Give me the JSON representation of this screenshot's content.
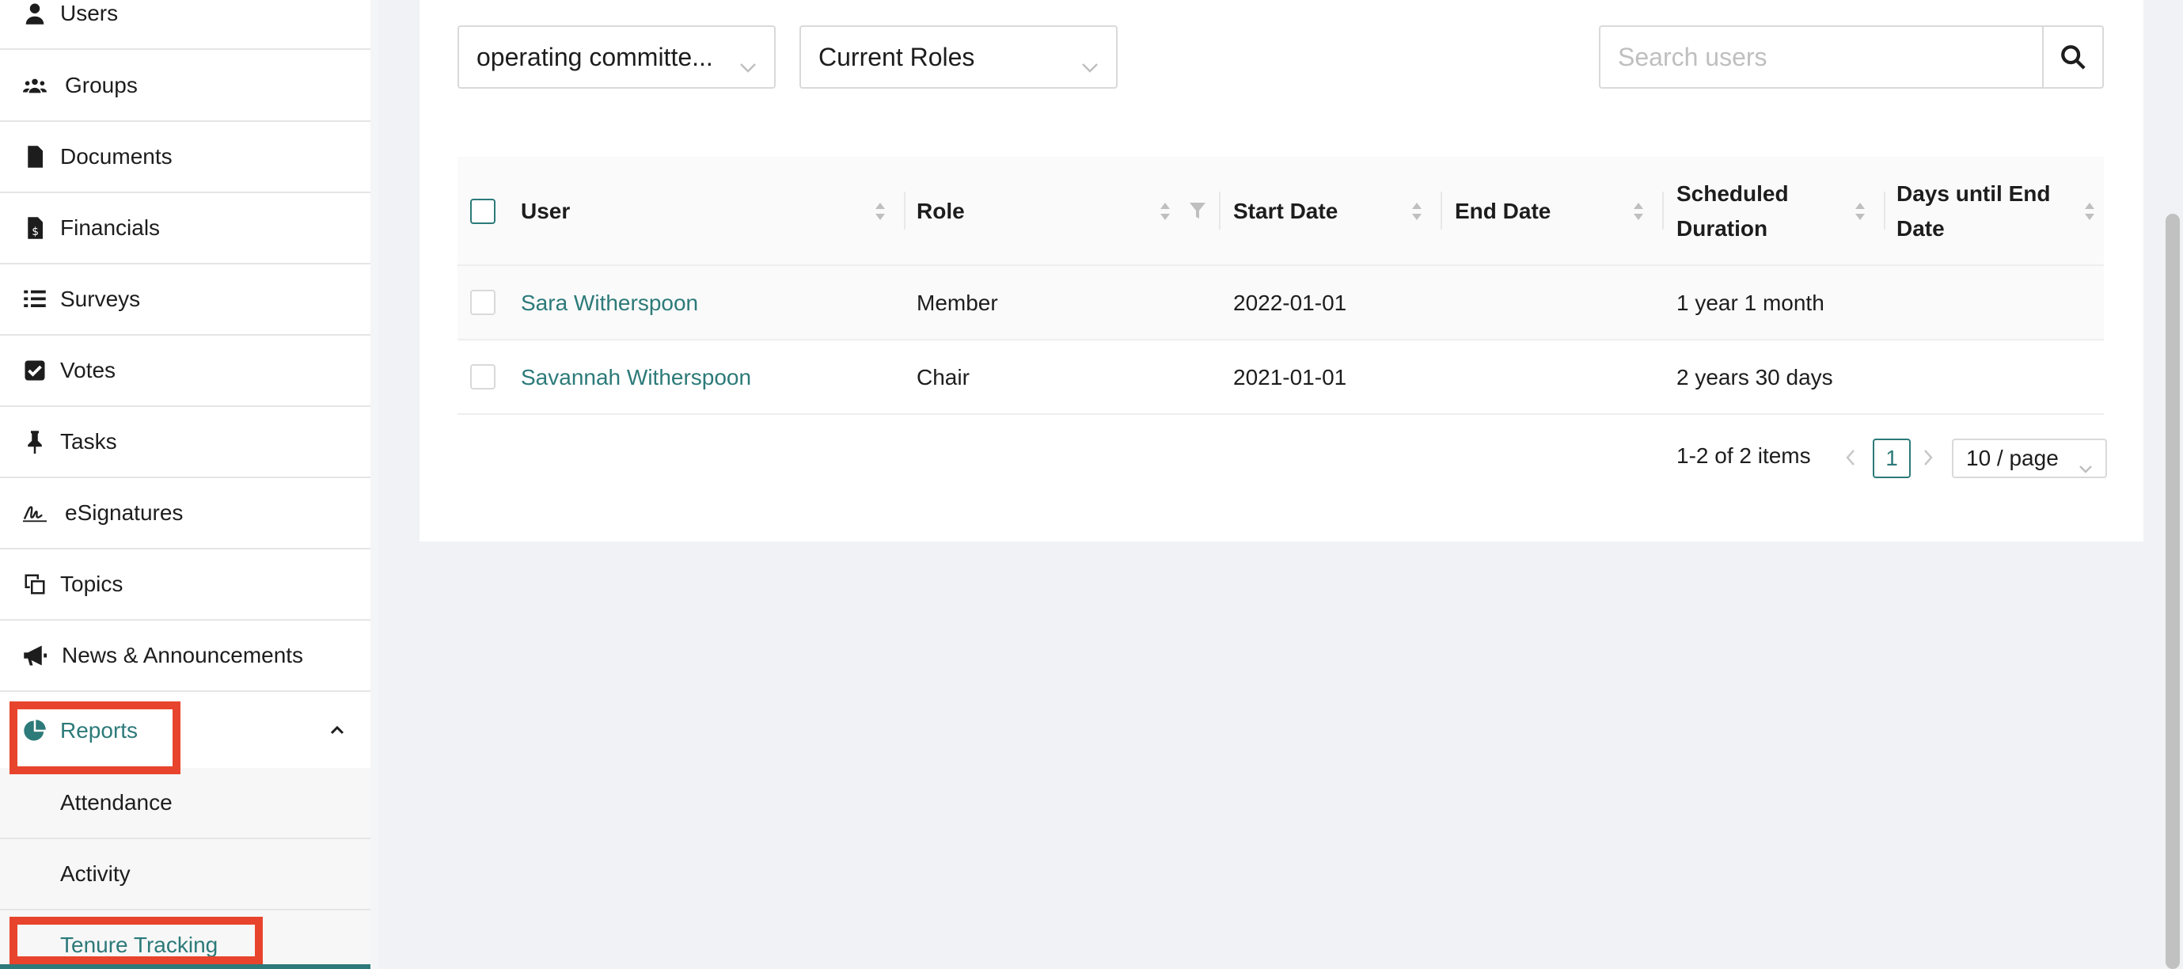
{
  "sidebar": {
    "items": [
      {
        "label": "Users",
        "icon": "user-icon"
      },
      {
        "label": "Groups",
        "icon": "groups-icon"
      },
      {
        "label": "Documents",
        "icon": "document-icon"
      },
      {
        "label": "Financials",
        "icon": "financials-icon"
      },
      {
        "label": "Surveys",
        "icon": "list-icon"
      },
      {
        "label": "Votes",
        "icon": "checkbox-icon"
      },
      {
        "label": "Tasks",
        "icon": "pin-icon"
      },
      {
        "label": "eSignatures",
        "icon": "signature-icon"
      },
      {
        "label": "Topics",
        "icon": "topics-icon"
      },
      {
        "label": "News & Announcements",
        "icon": "megaphone-icon"
      }
    ],
    "reports": {
      "label": "Reports",
      "icon": "pie-chart-icon",
      "expanded": true
    },
    "sub_items": [
      {
        "label": "Attendance"
      },
      {
        "label": "Activity"
      },
      {
        "label": "Tenure Tracking",
        "active": true
      }
    ]
  },
  "filters": {
    "group_select": "operating committe...",
    "roles_select": "Current Roles"
  },
  "search": {
    "placeholder": "Search users",
    "value": ""
  },
  "table": {
    "columns": [
      {
        "label": "User"
      },
      {
        "label": "Role"
      },
      {
        "label": "Start Date"
      },
      {
        "label": "End Date"
      },
      {
        "label": "Scheduled Duration"
      },
      {
        "label": "Days until End Date"
      }
    ],
    "rows": [
      {
        "user": "Sara Witherspoon",
        "role": "Member",
        "start_date": "2022-01-01",
        "end_date": "",
        "duration": "1 year 1 month",
        "days_until_end": ""
      },
      {
        "user": "Savannah Witherspoon",
        "role": "Chair",
        "start_date": "2021-01-01",
        "end_date": "",
        "duration": "2 years 30 days",
        "days_until_end": ""
      }
    ]
  },
  "pagination": {
    "total": "1-2 of 2 items",
    "current_page": "1",
    "page_size": "10 / page"
  },
  "colors": {
    "accent": "#2c7a79",
    "highlight": "#e8442d"
  }
}
